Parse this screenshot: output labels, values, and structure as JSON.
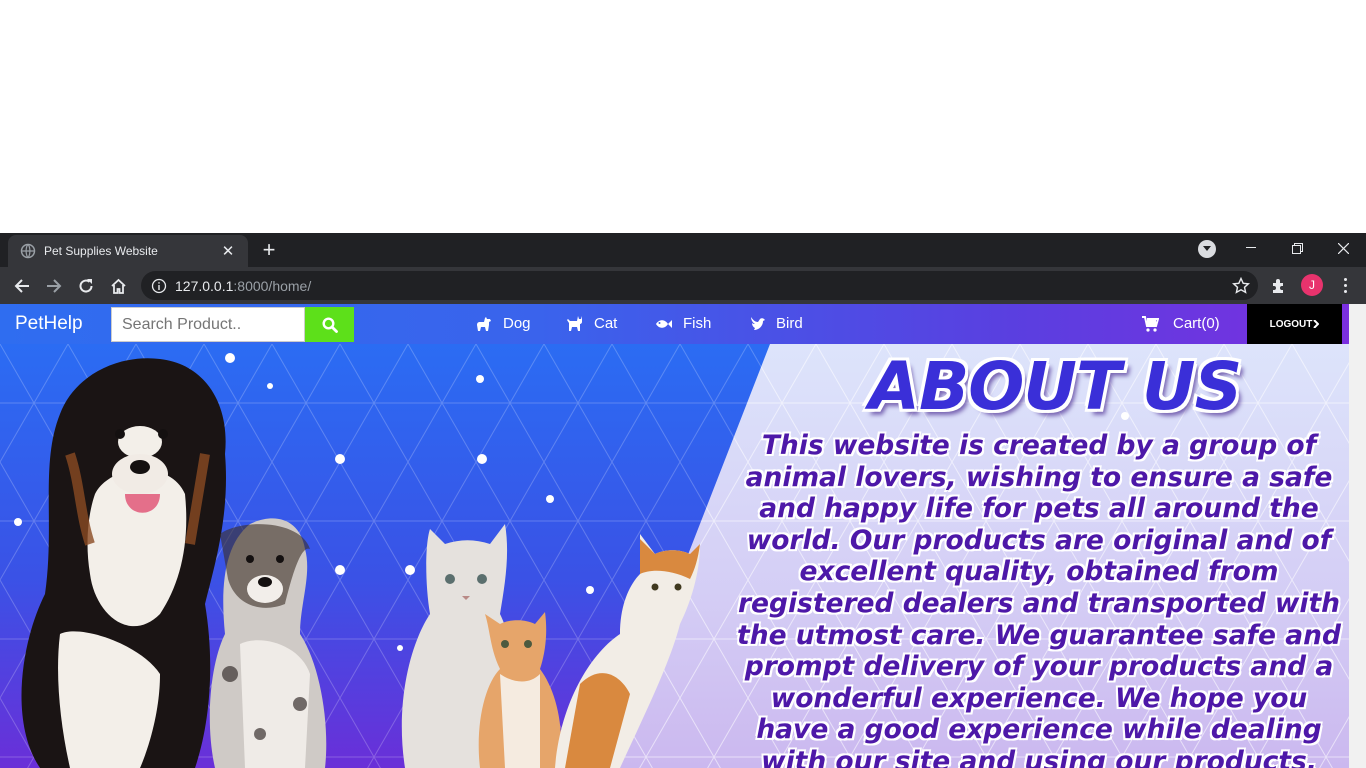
{
  "browser": {
    "tab_title": "Pet Supplies Website",
    "url_host": "127.0.0.1",
    "url_path": ":8000/home/",
    "profile_initial": "J"
  },
  "site": {
    "brand": "PetHelp",
    "search_placeholder": "Search Product..",
    "nav": [
      {
        "label": "Dog",
        "icon": "dog-icon"
      },
      {
        "label": "Cat",
        "icon": "cat-icon"
      },
      {
        "label": "Fish",
        "icon": "fish-icon"
      },
      {
        "label": "Bird",
        "icon": "bird-icon"
      }
    ],
    "cart_label": "Cart(0)",
    "logout_label": "LOGOUT",
    "colors": {
      "nav_start": "#2f6df0",
      "nav_end": "#7a2fe0",
      "search_button": "#5de01a",
      "logout_bg": "#000000",
      "heading": "#3a2fd8",
      "body_text": "#4d18a8"
    }
  },
  "hero": {
    "title": "ABOUT US",
    "text": "This website is created by a  group of animal lovers, wishing to ensure a safe and happy life for pets all around the world. Our products are original and of excellent quality, obtained from registered dealers and transported with the utmost care. We guarantee safe and prompt delivery of your products and a wonderful experience. We hope you have a good experience while dealing with our site and using our products."
  }
}
